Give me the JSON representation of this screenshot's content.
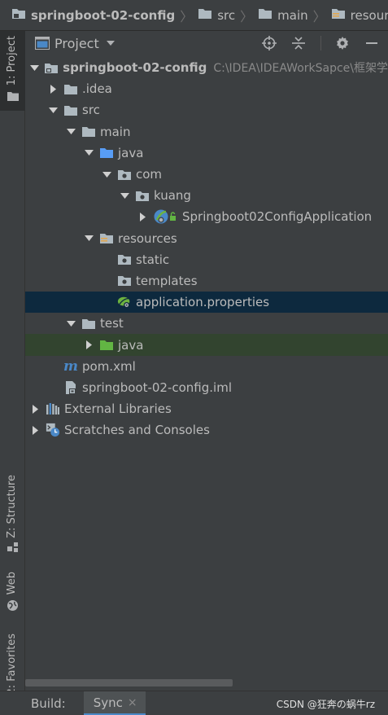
{
  "breadcrumb": {
    "items": [
      {
        "label": "springboot-02-config"
      },
      {
        "label": "src"
      },
      {
        "label": "main"
      },
      {
        "label": "resources"
      }
    ]
  },
  "sidebar": {
    "tabs": [
      {
        "label": "1: Project",
        "icon": "folder-icon"
      },
      {
        "label": "Z: Structure",
        "icon": "structure-icon"
      },
      {
        "label": "Web",
        "icon": "globe-icon"
      },
      {
        "label": "2: Favorites",
        "icon": "star-icon"
      }
    ]
  },
  "panel": {
    "title": "Project"
  },
  "tree": {
    "rows": [
      {
        "label": "springboot-02-config",
        "path": "C:\\IDEA\\IDEAWorkSapce\\框架学"
      },
      {
        "label": ".idea"
      },
      {
        "label": "src"
      },
      {
        "label": "main"
      },
      {
        "label": "java"
      },
      {
        "label": "com"
      },
      {
        "label": "kuang"
      },
      {
        "label": "Springboot02ConfigApplication"
      },
      {
        "label": "resources"
      },
      {
        "label": "static"
      },
      {
        "label": "templates"
      },
      {
        "label": "application.properties"
      },
      {
        "label": "test"
      },
      {
        "label": "java"
      },
      {
        "label": "pom.xml"
      },
      {
        "label": "springboot-02-config.iml"
      },
      {
        "label": "External Libraries"
      },
      {
        "label": "Scratches and Consoles"
      }
    ]
  },
  "bottom": {
    "build_label": "Build:",
    "sync_label": "Sync",
    "close_glyph": "×",
    "watermark": "CSDN @狂奔の蜗牛rz"
  },
  "colors": {
    "background": "#3c3f41",
    "selected_row": "#0d293e",
    "highlight_row": "#32442f",
    "folder": "#aeb9c0",
    "source_folder": "#589df6",
    "test_folder": "#62b543",
    "resource_folder": "#e2a74f"
  }
}
